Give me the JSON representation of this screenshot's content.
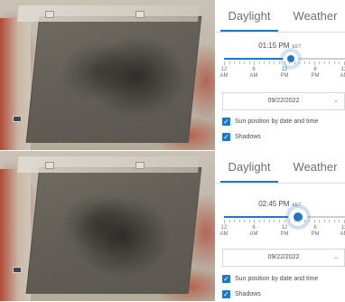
{
  "accent_color": "#1e78c8",
  "panels": [
    {
      "tabs": {
        "daylight": "Daylight",
        "weather": "Weather"
      },
      "time": "01:15 PM",
      "time_zone": "EET",
      "slider_value_fraction": 0.55,
      "tick_labels": [
        {
          "value": "12",
          "period": "AM"
        },
        {
          "value": "6",
          "period": "AM"
        },
        {
          "value": "12",
          "period": "PM"
        },
        {
          "value": "6",
          "period": "PM"
        },
        {
          "value": "12",
          "period": "AM"
        }
      ],
      "date": "09/22/2022",
      "sun_position_label": "Sun position by date and time",
      "shadows_label": "Shadows",
      "sun_position_checked": true,
      "shadows_checked": true
    },
    {
      "tabs": {
        "daylight": "Daylight",
        "weather": "Weather"
      },
      "time": "02:45 PM",
      "time_zone": "EET",
      "slider_value_fraction": 0.615,
      "tick_labels": [
        {
          "value": "12",
          "period": "AM"
        },
        {
          "value": "6",
          "period": "AM"
        },
        {
          "value": "12",
          "period": "PM"
        },
        {
          "value": "6",
          "period": "PM"
        },
        {
          "value": "12",
          "period": "AM"
        }
      ],
      "date": "09/22/2022",
      "sun_position_label": "Sun position by date and time",
      "shadows_label": "Shadows",
      "sun_position_checked": true,
      "shadows_checked": true
    }
  ]
}
